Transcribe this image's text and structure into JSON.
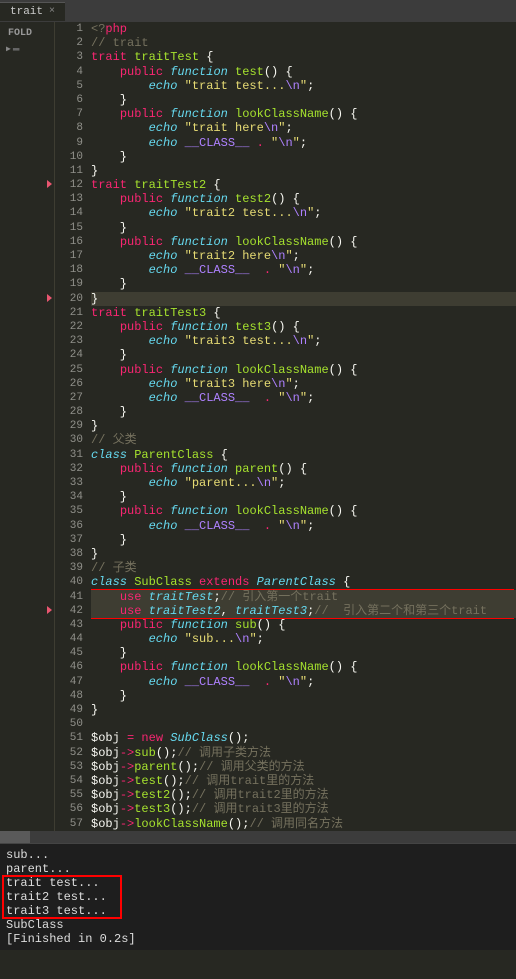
{
  "tab": {
    "label": "trait",
    "close": "×"
  },
  "sidebar": {
    "title": "FOLD"
  },
  "gutter": {
    "start": 1,
    "end": 57
  },
  "fold_markers": {
    "red": [
      12,
      20,
      42
    ],
    "yellow": []
  },
  "highlighted_lines": [
    20,
    41,
    42
  ],
  "red_boxes": {
    "code": {
      "top_line": 41,
      "bottom_line": 42
    },
    "console": {
      "top_line": 2,
      "bottom_line": 4
    }
  },
  "code_lines": [
    [
      [
        "k-gray",
        "<?"
      ],
      [
        "k-red",
        "php"
      ]
    ],
    [
      [
        "k-gray",
        "// trait"
      ]
    ],
    [
      [
        "k-red",
        "trait"
      ],
      [
        "k-white",
        " "
      ],
      [
        "k-green",
        "traitTest"
      ],
      [
        "k-white",
        " {"
      ]
    ],
    [
      [
        "k-white",
        "    "
      ],
      [
        "k-red",
        "public"
      ],
      [
        "k-white",
        " "
      ],
      [
        "k-blue",
        "function"
      ],
      [
        "k-white",
        " "
      ],
      [
        "k-green",
        "test"
      ],
      [
        "k-white",
        "() {"
      ]
    ],
    [
      [
        "k-white",
        "        "
      ],
      [
        "k-blue",
        "echo"
      ],
      [
        "k-white",
        " "
      ],
      [
        "k-yellow",
        "\"trait test..."
      ],
      [
        "k-purple",
        "\\n"
      ],
      [
        "k-yellow",
        "\""
      ],
      [
        "k-white",
        ";"
      ]
    ],
    [
      [
        "k-white",
        "    }"
      ]
    ],
    [
      [
        "k-white",
        "    "
      ],
      [
        "k-red",
        "public"
      ],
      [
        "k-white",
        " "
      ],
      [
        "k-blue",
        "function"
      ],
      [
        "k-white",
        " "
      ],
      [
        "k-green",
        "lookClassName"
      ],
      [
        "k-white",
        "() {"
      ]
    ],
    [
      [
        "k-white",
        "        "
      ],
      [
        "k-blue",
        "echo"
      ],
      [
        "k-white",
        " "
      ],
      [
        "k-yellow",
        "\"trait here"
      ],
      [
        "k-purple",
        "\\n"
      ],
      [
        "k-yellow",
        "\""
      ],
      [
        "k-white",
        ";"
      ]
    ],
    [
      [
        "k-white",
        "        "
      ],
      [
        "k-blue",
        "echo"
      ],
      [
        "k-white",
        " "
      ],
      [
        "k-purple",
        "__CLASS__"
      ],
      [
        "k-white",
        " "
      ],
      [
        "k-red",
        "."
      ],
      [
        "k-white",
        " "
      ],
      [
        "k-yellow",
        "\""
      ],
      [
        "k-purple",
        "\\n"
      ],
      [
        "k-yellow",
        "\""
      ],
      [
        "k-white",
        ";"
      ]
    ],
    [
      [
        "k-white",
        "    }"
      ]
    ],
    [
      [
        "k-white",
        "}"
      ]
    ],
    [
      [
        "k-red",
        "trait"
      ],
      [
        "k-white",
        " "
      ],
      [
        "k-green",
        "traitTest2"
      ],
      [
        "k-white",
        " {"
      ]
    ],
    [
      [
        "k-white",
        "    "
      ],
      [
        "k-red",
        "public"
      ],
      [
        "k-white",
        " "
      ],
      [
        "k-blue",
        "function"
      ],
      [
        "k-white",
        " "
      ],
      [
        "k-green",
        "test2"
      ],
      [
        "k-white",
        "() {"
      ]
    ],
    [
      [
        "k-white",
        "        "
      ],
      [
        "k-blue",
        "echo"
      ],
      [
        "k-white",
        " "
      ],
      [
        "k-yellow",
        "\"trait2 test..."
      ],
      [
        "k-purple",
        "\\n"
      ],
      [
        "k-yellow",
        "\""
      ],
      [
        "k-white",
        ";"
      ]
    ],
    [
      [
        "k-white",
        "    }"
      ]
    ],
    [
      [
        "k-white",
        "    "
      ],
      [
        "k-red",
        "public"
      ],
      [
        "k-white",
        " "
      ],
      [
        "k-blue",
        "function"
      ],
      [
        "k-white",
        " "
      ],
      [
        "k-green",
        "lookClassName"
      ],
      [
        "k-white",
        "() {"
      ]
    ],
    [
      [
        "k-white",
        "        "
      ],
      [
        "k-blue",
        "echo"
      ],
      [
        "k-white",
        " "
      ],
      [
        "k-yellow",
        "\"trait2 here"
      ],
      [
        "k-purple",
        "\\n"
      ],
      [
        "k-yellow",
        "\""
      ],
      [
        "k-white",
        ";"
      ]
    ],
    [
      [
        "k-white",
        "        "
      ],
      [
        "k-blue",
        "echo"
      ],
      [
        "k-white",
        " "
      ],
      [
        "k-purple",
        "__CLASS__"
      ],
      [
        "k-white",
        "  "
      ],
      [
        "k-red",
        "."
      ],
      [
        "k-white",
        " "
      ],
      [
        "k-yellow",
        "\""
      ],
      [
        "k-purple",
        "\\n"
      ],
      [
        "k-yellow",
        "\""
      ],
      [
        "k-white",
        ";"
      ]
    ],
    [
      [
        "k-white",
        "    }"
      ]
    ],
    [
      [
        "k-white",
        "}"
      ]
    ],
    [
      [
        "k-red",
        "trait"
      ],
      [
        "k-white",
        " "
      ],
      [
        "k-green",
        "traitTest3"
      ],
      [
        "k-white",
        " {"
      ]
    ],
    [
      [
        "k-white",
        "    "
      ],
      [
        "k-red",
        "public"
      ],
      [
        "k-white",
        " "
      ],
      [
        "k-blue",
        "function"
      ],
      [
        "k-white",
        " "
      ],
      [
        "k-green",
        "test3"
      ],
      [
        "k-white",
        "() {"
      ]
    ],
    [
      [
        "k-white",
        "        "
      ],
      [
        "k-blue",
        "echo"
      ],
      [
        "k-white",
        " "
      ],
      [
        "k-yellow",
        "\"trait3 test..."
      ],
      [
        "k-purple",
        "\\n"
      ],
      [
        "k-yellow",
        "\""
      ],
      [
        "k-white",
        ";"
      ]
    ],
    [
      [
        "k-white",
        "    }"
      ]
    ],
    [
      [
        "k-white",
        "    "
      ],
      [
        "k-red",
        "public"
      ],
      [
        "k-white",
        " "
      ],
      [
        "k-blue",
        "function"
      ],
      [
        "k-white",
        " "
      ],
      [
        "k-green",
        "lookClassName"
      ],
      [
        "k-white",
        "() {"
      ]
    ],
    [
      [
        "k-white",
        "        "
      ],
      [
        "k-blue",
        "echo"
      ],
      [
        "k-white",
        " "
      ],
      [
        "k-yellow",
        "\"trait3 here"
      ],
      [
        "k-purple",
        "\\n"
      ],
      [
        "k-yellow",
        "\""
      ],
      [
        "k-white",
        ";"
      ]
    ],
    [
      [
        "k-white",
        "        "
      ],
      [
        "k-blue",
        "echo"
      ],
      [
        "k-white",
        " "
      ],
      [
        "k-purple",
        "__CLASS__"
      ],
      [
        "k-white",
        "  "
      ],
      [
        "k-red",
        "."
      ],
      [
        "k-white",
        " "
      ],
      [
        "k-yellow",
        "\""
      ],
      [
        "k-purple",
        "\\n"
      ],
      [
        "k-yellow",
        "\""
      ],
      [
        "k-white",
        ";"
      ]
    ],
    [
      [
        "k-white",
        "    }"
      ]
    ],
    [
      [
        "k-white",
        "}"
      ]
    ],
    [
      [
        "k-gray",
        "// 父类"
      ]
    ],
    [
      [
        "k-blue",
        "class"
      ],
      [
        "k-white",
        " "
      ],
      [
        "k-green",
        "ParentClass"
      ],
      [
        "k-white",
        " {"
      ]
    ],
    [
      [
        "k-white",
        "    "
      ],
      [
        "k-red",
        "public"
      ],
      [
        "k-white",
        " "
      ],
      [
        "k-blue",
        "function"
      ],
      [
        "k-white",
        " "
      ],
      [
        "k-green",
        "parent"
      ],
      [
        "k-white",
        "() {"
      ]
    ],
    [
      [
        "k-white",
        "        "
      ],
      [
        "k-blue",
        "echo"
      ],
      [
        "k-white",
        " "
      ],
      [
        "k-yellow",
        "\"parent..."
      ],
      [
        "k-purple",
        "\\n"
      ],
      [
        "k-yellow",
        "\""
      ],
      [
        "k-white",
        ";"
      ]
    ],
    [
      [
        "k-white",
        "    }"
      ]
    ],
    [
      [
        "k-white",
        "    "
      ],
      [
        "k-red",
        "public"
      ],
      [
        "k-white",
        " "
      ],
      [
        "k-blue",
        "function"
      ],
      [
        "k-white",
        " "
      ],
      [
        "k-green",
        "lookClassName"
      ],
      [
        "k-white",
        "() {"
      ]
    ],
    [
      [
        "k-white",
        "        "
      ],
      [
        "k-blue",
        "echo"
      ],
      [
        "k-white",
        " "
      ],
      [
        "k-purple",
        "__CLASS__"
      ],
      [
        "k-white",
        "  "
      ],
      [
        "k-red",
        "."
      ],
      [
        "k-white",
        " "
      ],
      [
        "k-yellow",
        "\""
      ],
      [
        "k-purple",
        "\\n"
      ],
      [
        "k-yellow",
        "\""
      ],
      [
        "k-white",
        ";"
      ]
    ],
    [
      [
        "k-white",
        "    }"
      ]
    ],
    [
      [
        "k-white",
        "}"
      ]
    ],
    [
      [
        "k-gray",
        "// 子类"
      ]
    ],
    [
      [
        "k-blue",
        "class"
      ],
      [
        "k-white",
        " "
      ],
      [
        "k-green",
        "SubClass"
      ],
      [
        "k-white",
        " "
      ],
      [
        "k-red",
        "extends"
      ],
      [
        "k-white",
        " "
      ],
      [
        "k-blue",
        "ParentClass"
      ],
      [
        "k-white",
        " {"
      ]
    ],
    [
      [
        "k-white",
        "    "
      ],
      [
        "k-red",
        "use"
      ],
      [
        "k-white",
        " "
      ],
      [
        "k-blue",
        "traitTest"
      ],
      [
        "k-white",
        ";"
      ],
      [
        "k-gray",
        "// 引入第一个trait"
      ]
    ],
    [
      [
        "k-white",
        "    "
      ],
      [
        "k-red",
        "use"
      ],
      [
        "k-white",
        " "
      ],
      [
        "k-blue",
        "traitTest2"
      ],
      [
        "k-white",
        ", "
      ],
      [
        "k-blue",
        "traitTest3"
      ],
      [
        "k-white",
        ";"
      ],
      [
        "k-gray",
        "//  引入第二个和第三个trait"
      ]
    ],
    [
      [
        "k-white",
        "    "
      ],
      [
        "k-red",
        "public"
      ],
      [
        "k-white",
        " "
      ],
      [
        "k-blue",
        "function"
      ],
      [
        "k-white",
        " "
      ],
      [
        "k-green",
        "sub"
      ],
      [
        "k-white",
        "() {"
      ]
    ],
    [
      [
        "k-white",
        "        "
      ],
      [
        "k-blue",
        "echo"
      ],
      [
        "k-white",
        " "
      ],
      [
        "k-yellow",
        "\"sub..."
      ],
      [
        "k-purple",
        "\\n"
      ],
      [
        "k-yellow",
        "\""
      ],
      [
        "k-white",
        ";"
      ]
    ],
    [
      [
        "k-white",
        "    }"
      ]
    ],
    [
      [
        "k-white",
        "    "
      ],
      [
        "k-red",
        "public"
      ],
      [
        "k-white",
        " "
      ],
      [
        "k-blue",
        "function"
      ],
      [
        "k-white",
        " "
      ],
      [
        "k-green",
        "lookClassName"
      ],
      [
        "k-white",
        "() {"
      ]
    ],
    [
      [
        "k-white",
        "        "
      ],
      [
        "k-blue",
        "echo"
      ],
      [
        "k-white",
        " "
      ],
      [
        "k-purple",
        "__CLASS__"
      ],
      [
        "k-white",
        "  "
      ],
      [
        "k-red",
        "."
      ],
      [
        "k-white",
        " "
      ],
      [
        "k-yellow",
        "\""
      ],
      [
        "k-purple",
        "\\n"
      ],
      [
        "k-yellow",
        "\""
      ],
      [
        "k-white",
        ";"
      ]
    ],
    [
      [
        "k-white",
        "    }"
      ]
    ],
    [
      [
        "k-white",
        "}"
      ]
    ],
    [
      [
        "k-white",
        ""
      ]
    ],
    [
      [
        "k-white",
        "$obj "
      ],
      [
        "k-red",
        "="
      ],
      [
        "k-white",
        " "
      ],
      [
        "k-red",
        "new"
      ],
      [
        "k-white",
        " "
      ],
      [
        "k-blue",
        "SubClass"
      ],
      [
        "k-white",
        "();"
      ]
    ],
    [
      [
        "k-white",
        "$obj"
      ],
      [
        "k-red",
        "->"
      ],
      [
        "k-green",
        "sub"
      ],
      [
        "k-white",
        "();"
      ],
      [
        "k-gray",
        "// 调用子类方法"
      ]
    ],
    [
      [
        "k-white",
        "$obj"
      ],
      [
        "k-red",
        "->"
      ],
      [
        "k-green",
        "parent"
      ],
      [
        "k-white",
        "();"
      ],
      [
        "k-gray",
        "// 调用父类的方法"
      ]
    ],
    [
      [
        "k-white",
        "$obj"
      ],
      [
        "k-red",
        "->"
      ],
      [
        "k-green",
        "test"
      ],
      [
        "k-white",
        "();"
      ],
      [
        "k-gray",
        "// 调用trait里的方法"
      ]
    ],
    [
      [
        "k-white",
        "$obj"
      ],
      [
        "k-red",
        "->"
      ],
      [
        "k-green",
        "test2"
      ],
      [
        "k-white",
        "();"
      ],
      [
        "k-gray",
        "// 调用trait2里的方法"
      ]
    ],
    [
      [
        "k-white",
        "$obj"
      ],
      [
        "k-red",
        "->"
      ],
      [
        "k-green",
        "test3"
      ],
      [
        "k-white",
        "();"
      ],
      [
        "k-gray",
        "// 调用trait3里的方法"
      ]
    ],
    [
      [
        "k-white",
        "$obj"
      ],
      [
        "k-red",
        "->"
      ],
      [
        "k-green",
        "lookClassName"
      ],
      [
        "k-white",
        "();"
      ],
      [
        "k-gray",
        "// 调用同名方法"
      ]
    ]
  ],
  "console_lines": [
    "sub...",
    "parent...",
    "trait test...",
    "trait2 test...",
    "trait3 test...",
    "SubClass",
    "[Finished in 0.2s]"
  ]
}
